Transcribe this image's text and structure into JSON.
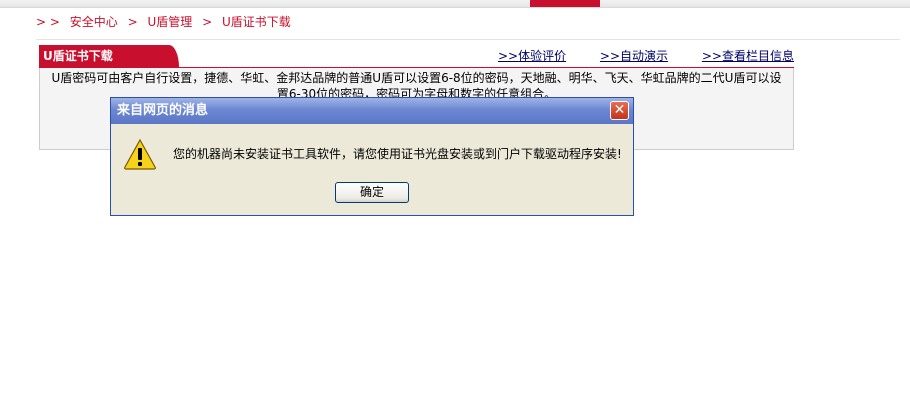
{
  "breadcrumb": {
    "separator": "> >",
    "items": [
      "安全中心",
      "U盾管理",
      "U盾证书下载"
    ]
  },
  "panel": {
    "tab_title": "U盾证书下载",
    "links": [
      {
        "prefix": ">>",
        "label": "体验评价"
      },
      {
        "prefix": ">>",
        "label": "自动演示"
      },
      {
        "prefix": ">>",
        "label": "查看栏目信息"
      }
    ],
    "body_text": "U盾密码可由客户自行设置，捷德、华虹、金邦达品牌的普通U盾可以设置6-8位的密码，天地融、明华、飞天、华虹品牌的二代U盾可以设置6-30位的密码，密码可为字母和数字的任意组合。"
  },
  "dialog": {
    "title": "来自网页的消息",
    "message": "您的机器尚未安装证书工具软件，请您使用证书光盘安装或到门户下载驱动程序安装!",
    "ok_label": "确定",
    "icon": "warning-icon"
  },
  "colors": {
    "accent": "#c8102e",
    "link": "#000066",
    "dialog_title": "#5a76c6",
    "dialog_bg": "#ece9d8"
  }
}
